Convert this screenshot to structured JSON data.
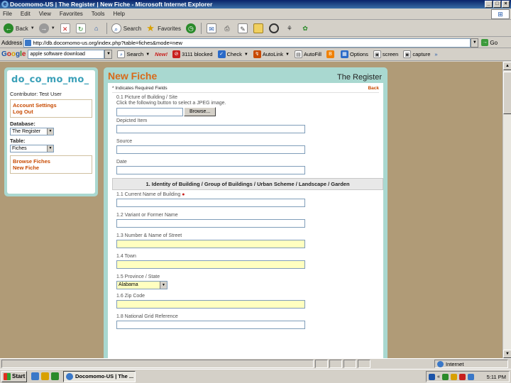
{
  "window": {
    "title": "Docomomo-US | The Register | New Fiche - Microsoft Internet Explorer"
  },
  "menu": [
    "File",
    "Edit",
    "View",
    "Favorites",
    "Tools",
    "Help"
  ],
  "toolbar": {
    "back": "Back",
    "search": "Search",
    "favorites": "Favorites"
  },
  "address": {
    "label": "Address",
    "url": "http://db.docomomo-us.org/index.php?table=fiches&mode=new",
    "go": "Go"
  },
  "googlebar": {
    "query": "apple software download",
    "search": "Search",
    "new_badge": "New!",
    "blocked": "3111 blocked",
    "check": "Check",
    "autolink": "AutoLink",
    "autofill": "AutoFill",
    "options": "Options",
    "screen": "screen",
    "capture": "capture"
  },
  "sidebar": {
    "logo": "do_co_mo_mo_",
    "contributor": "Contributor: Test User",
    "account_settings": "Account Settings",
    "logout": "Log Out",
    "database_label": "Database:",
    "database_value": "The Register",
    "table_label": "Table:",
    "table_value": "Fiches",
    "browse_fiches": "Browse Fiches",
    "new_fiche": "New Fiche"
  },
  "main": {
    "title": "New Fiche",
    "register": "The Register",
    "required_note": "* Indicates Required Fields",
    "back": "Back",
    "f_picture": "0.1 Picture of Building / Site",
    "f_picture_hint": "Click the following button to select a JPEG image.",
    "browse": "Browse...",
    "f_depicted": "Depicted Item",
    "f_source": "Source",
    "f_date": "Date",
    "section1": "1. Identity of Building / Group of Buildings / Urban Scheme / Landscape / Garden",
    "f_current_name": "1.1 Current Name of Building",
    "f_variant_name": "1.2 Variant or Former Name",
    "f_number_street": "1.3 Number & Name of Street",
    "f_town": "1.4 Town",
    "f_province": "1.5 Province / State",
    "province_value": "Alabama",
    "f_zip": "1.6 Zip Code",
    "f_national_grid": "1.8 National Grid Reference"
  },
  "statusbar": {
    "zone": "Internet"
  },
  "taskbar": {
    "start": "Start",
    "task": "Docomomo-US | The ...",
    "clock": "5:11 PM"
  }
}
